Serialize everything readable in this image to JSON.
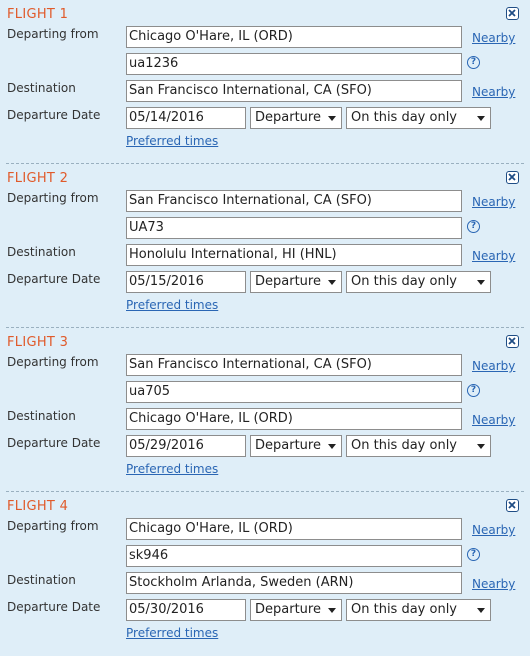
{
  "labels": {
    "departing_from": "Departing from",
    "destination": "Destination",
    "departure_date": "Departure Date",
    "nearby": "Nearby",
    "preferred_times": "Preferred times",
    "help": "?"
  },
  "flights": [
    {
      "title": "FLIGHT 1",
      "departing_from": "Chicago O'Hare, IL (ORD)",
      "flight_number": "ua1236",
      "destination": "San Francisco International, CA (SFO)",
      "date": "05/14/2016",
      "direction": "Departure",
      "flexibility": "On this day only"
    },
    {
      "title": "FLIGHT 2",
      "departing_from": "San Francisco International, CA (SFO)",
      "flight_number": "UA73",
      "destination": "Honolulu International, HI (HNL)",
      "date": "05/15/2016",
      "direction": "Departure",
      "flexibility": "On this day only"
    },
    {
      "title": "FLIGHT 3",
      "departing_from": "San Francisco International, CA (SFO)",
      "flight_number": "ua705",
      "destination": "Chicago O'Hare, IL (ORD)",
      "date": "05/29/2016",
      "direction": "Departure",
      "flexibility": "On this day only"
    },
    {
      "title": "FLIGHT 4",
      "departing_from": "Chicago O'Hare, IL (ORD)",
      "flight_number": "sk946",
      "destination": "Stockholm Arlanda, Sweden (ARN)",
      "date": "05/30/2016",
      "direction": "Departure",
      "flexibility": "On this day only"
    }
  ]
}
